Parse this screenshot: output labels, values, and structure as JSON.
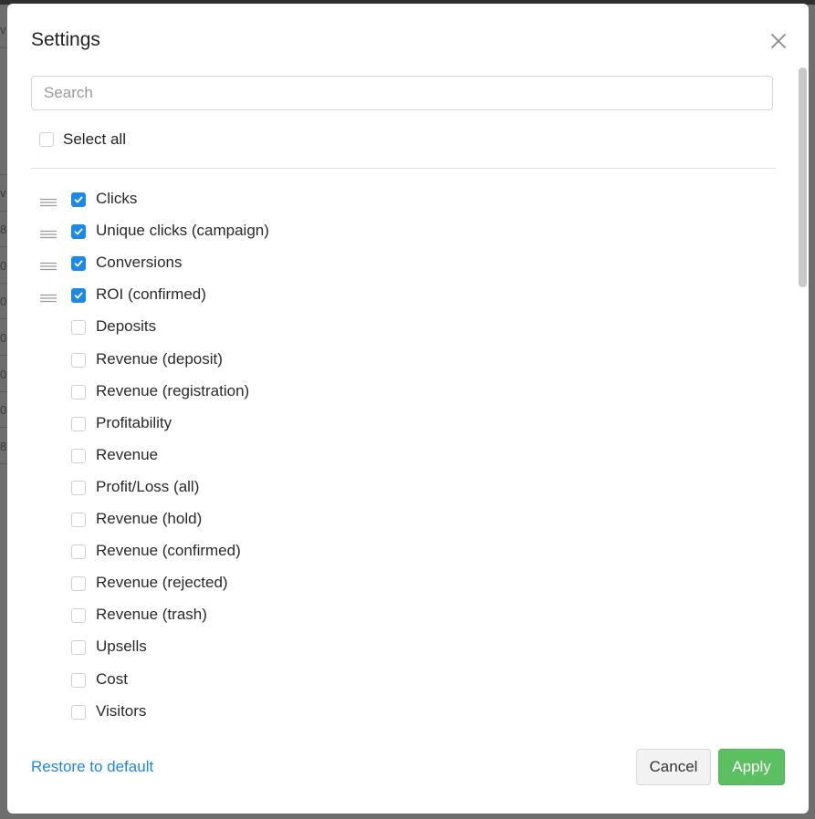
{
  "background": {
    "cells": [
      "v",
      "8",
      "0",
      "0",
      "0",
      "0",
      "0",
      "8"
    ]
  },
  "modal": {
    "title": "Settings",
    "close_icon": "close-icon",
    "search": {
      "placeholder": "Search",
      "value": ""
    },
    "select_all": {
      "label": "Select all",
      "checked": false
    },
    "columns": [
      {
        "label": "Clicks",
        "checked": true,
        "draggable": true
      },
      {
        "label": "Unique clicks (campaign)",
        "checked": true,
        "draggable": true
      },
      {
        "label": "Conversions",
        "checked": true,
        "draggable": true
      },
      {
        "label": "ROI (confirmed)",
        "checked": true,
        "draggable": true
      },
      {
        "label": "Deposits",
        "checked": false,
        "draggable": false
      },
      {
        "label": "Revenue (deposit)",
        "checked": false,
        "draggable": false
      },
      {
        "label": "Revenue (registration)",
        "checked": false,
        "draggable": false
      },
      {
        "label": "Profitability",
        "checked": false,
        "draggable": false
      },
      {
        "label": "Revenue",
        "checked": false,
        "draggable": false
      },
      {
        "label": "Profit/Loss (all)",
        "checked": false,
        "draggable": false
      },
      {
        "label": "Revenue (hold)",
        "checked": false,
        "draggable": false
      },
      {
        "label": "Revenue (confirmed)",
        "checked": false,
        "draggable": false
      },
      {
        "label": "Revenue (rejected)",
        "checked": false,
        "draggable": false
      },
      {
        "label": "Revenue (trash)",
        "checked": false,
        "draggable": false
      },
      {
        "label": "Upsells",
        "checked": false,
        "draggable": false
      },
      {
        "label": "Cost",
        "checked": false,
        "draggable": false
      },
      {
        "label": "Visitors",
        "checked": false,
        "draggable": false
      }
    ],
    "footer": {
      "restore_label": "Restore to default",
      "cancel_label": "Cancel",
      "apply_label": "Apply"
    },
    "colors": {
      "accent": "#1e88e5",
      "apply": "#5cbf62"
    }
  }
}
